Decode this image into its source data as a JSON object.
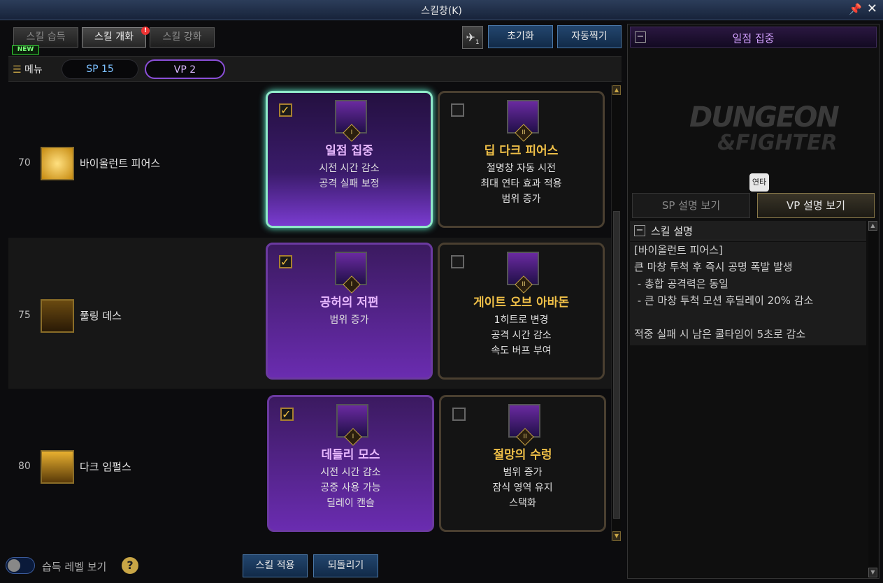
{
  "window": {
    "title": "스킬창(K)",
    "pin_icon": "pin-icon",
    "close_icon": "close-icon"
  },
  "tabs": [
    {
      "label": "스킬 습득"
    },
    {
      "label": "스킬 개화"
    },
    {
      "label": "스킬 강화"
    }
  ],
  "new_badge": "NEW",
  "alert_badge": "!",
  "toolbar": {
    "special_icon": "skill-slot-icon",
    "special_sub": "1",
    "reset_label": "초기화",
    "auto_label": "자동찍기"
  },
  "menubar": {
    "menu_label": "메뉴",
    "sp": "SP 15",
    "vp": "VP 2"
  },
  "rows": [
    {
      "level": "70",
      "name": "바이올런트 피어스",
      "options": [
        {
          "checked": true,
          "rank": "I",
          "title": "일점 집중",
          "lines": [
            "시전 시간 감소",
            "공격 실패 보정"
          ]
        },
        {
          "checked": false,
          "rank": "II",
          "title": "딥 다크 피어스",
          "lines": [
            "절명창 자동 시전",
            "최대 연타 효과 적용",
            "범위 증가"
          ]
        }
      ]
    },
    {
      "level": "75",
      "name": "풀링 데스",
      "options": [
        {
          "checked": true,
          "rank": "I",
          "title": "공허의 저편",
          "lines": [
            "범위 증가"
          ]
        },
        {
          "checked": false,
          "rank": "II",
          "title": "게이트 오브 아바돈",
          "lines": [
            "1히트로 변경",
            "공격 시간 감소",
            "속도 버프 부여"
          ]
        }
      ]
    },
    {
      "level": "80",
      "name": "다크 임펄스",
      "options": [
        {
          "checked": true,
          "rank": "I",
          "title": "데들리 모스",
          "lines": [
            "시전 시간 감소",
            "공중 사용 가능",
            "딜레이 캔슬"
          ]
        },
        {
          "checked": false,
          "rank": "II",
          "title": "절망의 수렁",
          "lines": [
            "범위 증가",
            "잠식 영역 유지",
            "스택화"
          ]
        }
      ]
    }
  ],
  "bottom": {
    "toggle_label": "습득 레벨 보기",
    "help": "?",
    "apply_label": "스킬 적용",
    "revert_label": "되돌리기"
  },
  "right_panel": {
    "title": "일점 집중",
    "collapse": "−",
    "logo_line1": "DUNGEON",
    "logo_line2": "&FIGHTER",
    "badge": "연타",
    "sp_tab": "SP 설명 보기",
    "vp_tab": "VP 설명 보기",
    "section_title": "스킬 설명",
    "desc_lines": [
      "[바이올런트 피어스]",
      "큰 마창 투척 후 즉시 공명 폭발 발생",
      " - 총합 공격력은 동일",
      " - 큰 마창 투척 모션 후딜레이 20% 감소",
      "",
      "적중 실패 시 남은 쿨타임이 5초로 감소"
    ]
  },
  "colors": {
    "accent_purple": "#8b4fd8",
    "gold": "#c9a646",
    "button_blue": "#23466e"
  }
}
